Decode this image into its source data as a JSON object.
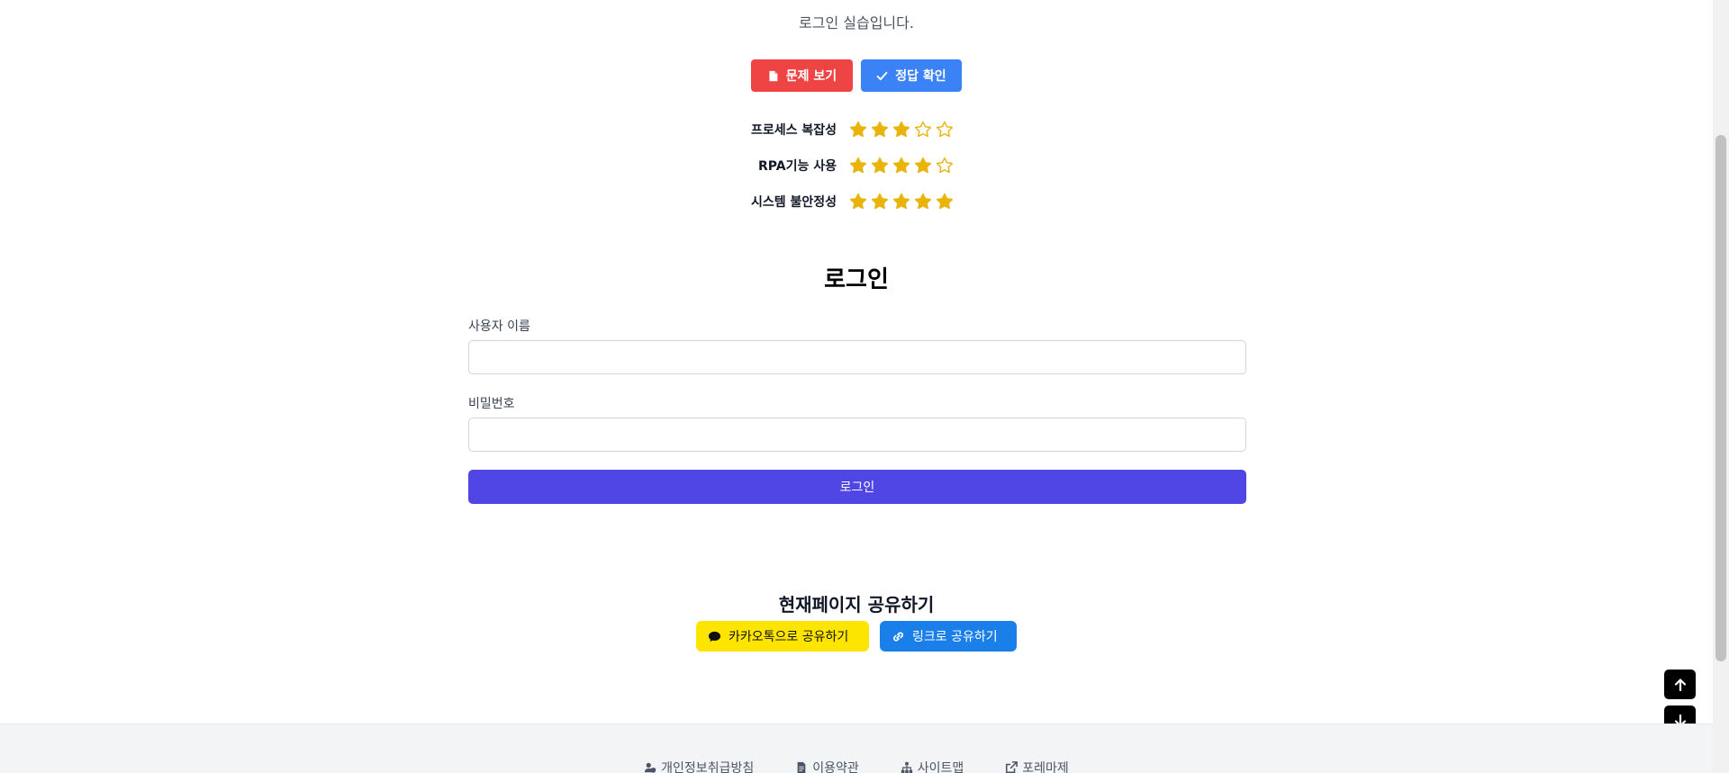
{
  "intro": {
    "subtitle": "로그인 실습입니다."
  },
  "actions": {
    "view_problem": "문제 보기",
    "check_answer": "정답 확인"
  },
  "ratings": [
    {
      "label": "프로세스 복잡성",
      "score": 3,
      "max": 5
    },
    {
      "label": "RPA기능 사용",
      "score": 4,
      "max": 5
    },
    {
      "label": "시스템 불안정성",
      "score": 5,
      "max": 5
    }
  ],
  "login": {
    "title": "로그인",
    "username_label": "사용자 이름",
    "username_value": "",
    "password_label": "비밀번호",
    "password_value": "",
    "submit_label": "로그인"
  },
  "share": {
    "title": "현재페이지 공유하기",
    "kakao_label": "카카오톡으로 공유하기",
    "link_label": "링크로 공유하기"
  },
  "footer": {
    "links": [
      {
        "label": "개인정보취급방침",
        "icon": "user-shield-icon"
      },
      {
        "label": "이용약관",
        "icon": "document-icon"
      },
      {
        "label": "사이트맵",
        "icon": "sitemap-icon"
      },
      {
        "label": "포레마제",
        "icon": "external-link-icon"
      }
    ]
  },
  "colors": {
    "primary": "#4f46e5",
    "danger": "#ef4444",
    "info": "#3b82f6",
    "star": "#eab308",
    "kakao": "#fee500",
    "link_share": "#1b7fea"
  }
}
